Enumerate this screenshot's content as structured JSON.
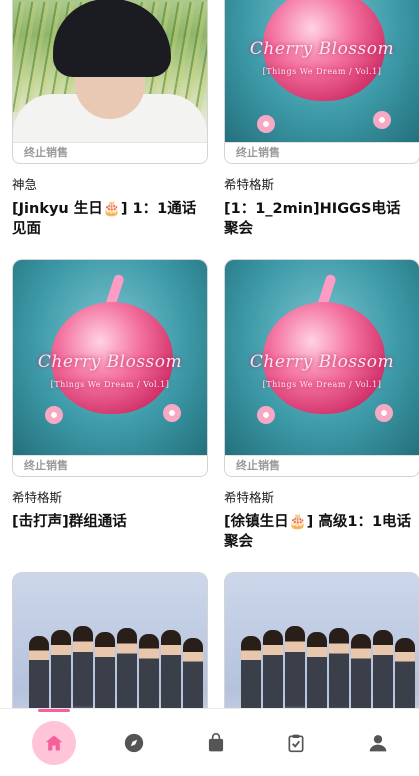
{
  "status_label": "终止销售",
  "products": [
    {
      "seller": "神急",
      "title": "[Jinkyu 生日🎂] 1：1通话见面",
      "art": "person"
    },
    {
      "seller": "希特格斯",
      "title": "[1：1_2min]HIGGS电话聚会",
      "art": "cherry"
    },
    {
      "seller": "希特格斯",
      "title": "[击打声]群组通话",
      "art": "cherry"
    },
    {
      "seller": "希特格斯",
      "title": "[徐镇生日🎂] 高级1：1电话聚会",
      "art": "cherry"
    },
    {
      "seller": "",
      "title": "",
      "art": "group"
    },
    {
      "seller": "",
      "title": "",
      "art": "group"
    }
  ],
  "cherry_logo_text": "Cherry Blossom",
  "cherry_logo_subtext": "[Things We Dream / Vol.1]",
  "tabs": [
    {
      "icon": "home-icon",
      "active": true
    },
    {
      "icon": "compass-icon",
      "active": false
    },
    {
      "icon": "shopping-bag-icon",
      "active": false
    },
    {
      "icon": "clipboard-check-icon",
      "active": false
    },
    {
      "icon": "person-icon",
      "active": false
    }
  ],
  "colors": {
    "accent": "#f6609a",
    "active_tab_bg": "#ffc4d8",
    "icon": "#555555"
  }
}
